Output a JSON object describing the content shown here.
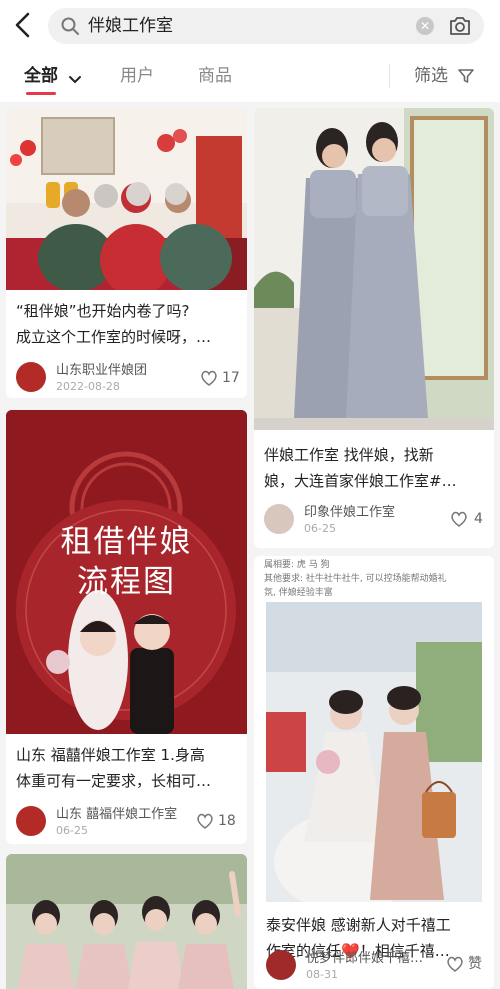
{
  "search": {
    "query": "伴娘工作室"
  },
  "tabs": [
    {
      "label": "全部"
    },
    {
      "label": "用户"
    },
    {
      "label": "商品"
    }
  ],
  "filter_label": "筛选",
  "cards": [
    {
      "title_line1": "“租伴娘”也开始内卷了吗?",
      "title_line2": "成立这个工作室的时候呀，…",
      "author": "山东职业伴娘团",
      "date": "2022-08-28",
      "likes": "17"
    },
    {
      "title_line1": "伴娘工作室 找伴娘，找新",
      "title_line2": "娘，大连首家伴娘工作室#…",
      "author": "印象伴娘工作室",
      "date": "06-25",
      "likes": "4"
    },
    {
      "poster_line1": "租借伴娘",
      "poster_line2": "流程图",
      "title_line1": "山东 福囍伴娘工作室 1.身高",
      "title_line2": "体重可有一定要求，长相可…",
      "author": "山东 囍福伴娘工作室",
      "date": "06-25",
      "likes": "18"
    },
    {
      "note_line1": "属相要: 虎 马 狗",
      "note_line2": "其他要求: 社牛社牛社牛, 可以控场能帮动婚礼",
      "note_line3": "氛, 伴娘经验丰富",
      "title_line1": "泰安伴娘 感谢新人对千禧工",
      "title_line2a": "作室的信任",
      "title_heart": "❤️",
      "title_line2b": "！相信千禧…",
      "author": "悦梦伴郎伴娘千禧…",
      "date": "08-31",
      "likes": "赞"
    }
  ],
  "colors": {
    "accent": "#e23a4a",
    "poster_red": "#8e1a1f"
  }
}
